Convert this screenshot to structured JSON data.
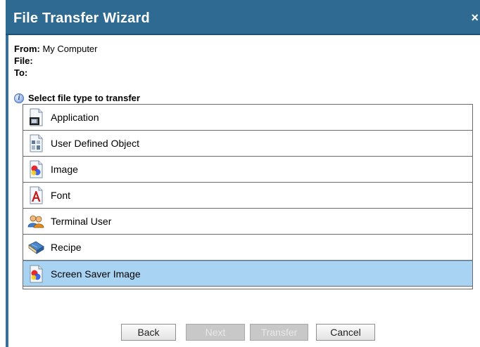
{
  "window": {
    "title": "File Transfer Wizard",
    "close_glyph": "×"
  },
  "transfer": {
    "from_label": "From:",
    "from_value": "My Computer",
    "file_label": "File:",
    "file_value": "",
    "to_label": "To:",
    "to_value": ""
  },
  "file_types": {
    "header": "Select file type to transfer",
    "info_icon": "info-icon",
    "items": [
      {
        "label": "Application",
        "icon": "application-icon",
        "selected": false
      },
      {
        "label": "User Defined Object",
        "icon": "user-defined-object-icon",
        "selected": false
      },
      {
        "label": "Image",
        "icon": "image-icon",
        "selected": false
      },
      {
        "label": "Font",
        "icon": "font-icon",
        "selected": false
      },
      {
        "label": "Terminal User",
        "icon": "terminal-user-icon",
        "selected": false
      },
      {
        "label": "Recipe",
        "icon": "recipe-icon",
        "selected": false
      },
      {
        "label": "Screen Saver Image",
        "icon": "screen-saver-image-icon",
        "selected": true
      }
    ]
  },
  "buttons": {
    "back": "Back",
    "next": "Next",
    "transfer": "Transfer",
    "cancel": "Cancel"
  },
  "colors": {
    "titlebar": "#2f6a92",
    "selected_row": "#a9d3f3",
    "disabled_button": "#c8c8c8"
  }
}
